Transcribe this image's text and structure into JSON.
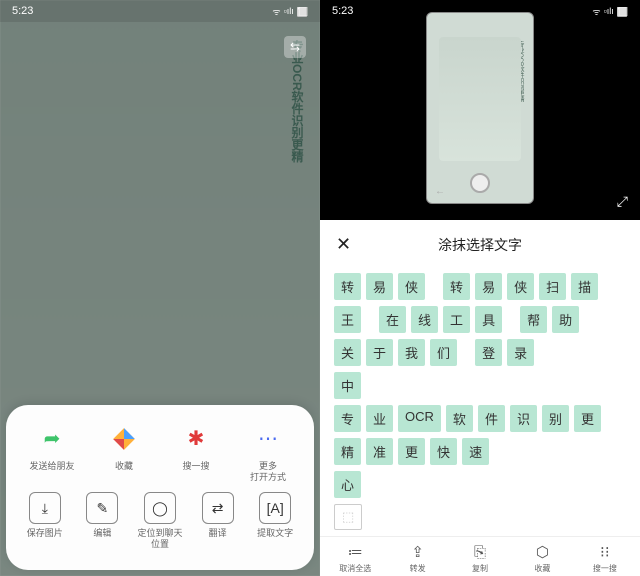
{
  "status": {
    "time": "5:23",
    "wifi": "ᯤ",
    "signal": "▫ılı",
    "battery": "⬜⃞"
  },
  "left": {
    "bg_title": "专业OCR软件识别更精",
    "swap": "⇆",
    "row1": [
      {
        "icon_color": "#3ec46a",
        "glyph": "➦",
        "label": "发送给朋友"
      },
      {
        "icon_color": "#ff5a3c",
        "glyph": "◆",
        "label": "收藏",
        "multi": true
      },
      {
        "icon_color": "#e03a3a",
        "glyph": "✱",
        "label": "搜一搜"
      },
      {
        "icon_color": "#4a6af0",
        "glyph": "⋯",
        "label": "更多\n打开方式"
      }
    ],
    "row2": [
      {
        "glyph": "⤓",
        "label": "保存图片"
      },
      {
        "glyph": "✎",
        "label": "编辑"
      },
      {
        "glyph": "◯",
        "label": "定位到聊天\n位置"
      },
      {
        "glyph": "⇄",
        "label": "翻译",
        "boxed": true
      },
      {
        "glyph": "[A]",
        "label": "提取文字"
      }
    ]
  },
  "right": {
    "title": "涂抹选择文字",
    "close": "✕",
    "expand": "⤢",
    "lines": [
      [
        "转",
        "易",
        "侠",
        "",
        "转",
        "易",
        "侠",
        "扫",
        "描"
      ],
      [
        "王",
        "",
        "在",
        "线",
        "工",
        "具",
        "",
        "帮",
        "助"
      ],
      [
        "关",
        "于",
        "我",
        "们",
        "",
        "登",
        "录"
      ],
      [
        "中"
      ],
      [
        "专",
        "业",
        "OCR",
        "软",
        "件",
        "识",
        "别",
        "更"
      ],
      [
        "精",
        "准",
        "更",
        "快",
        "速"
      ],
      [
        "心"
      ],
      [
        "⬚"
      ]
    ],
    "toolbar": [
      {
        "glyph": "≔",
        "label": "取消全选"
      },
      {
        "glyph": "⇪",
        "label": "转发"
      },
      {
        "glyph": "⎘",
        "label": "复制"
      },
      {
        "glyph": "⬡",
        "label": "收藏"
      },
      {
        "glyph": "⁝⁝",
        "label": "搜一搜"
      }
    ]
  }
}
